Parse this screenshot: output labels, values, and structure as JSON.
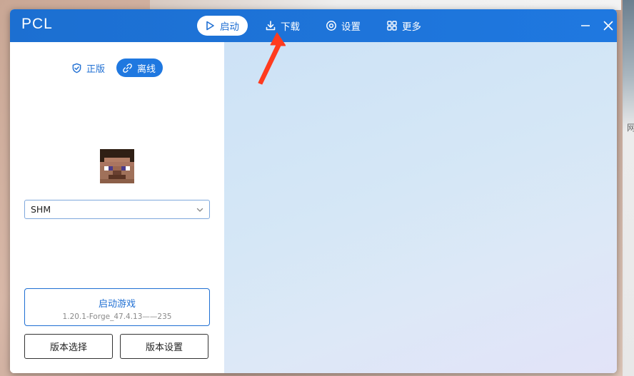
{
  "window": {
    "title": "PCL"
  },
  "nav": {
    "items": [
      {
        "label": "启动",
        "icon": "play-icon",
        "active": true
      },
      {
        "label": "下载",
        "icon": "download-icon",
        "active": false
      },
      {
        "label": "设置",
        "icon": "settings-icon",
        "active": false
      },
      {
        "label": "更多",
        "icon": "grid-icon",
        "active": false
      }
    ]
  },
  "account": {
    "tabs": [
      {
        "label": "正版",
        "icon": "shield-check-icon",
        "active": false
      },
      {
        "label": "离线",
        "icon": "link-icon",
        "active": true
      }
    ]
  },
  "user": {
    "selected": "SHM"
  },
  "launch": {
    "label": "启动游戏",
    "version": "1.20.1-Forge_47.4.13——235"
  },
  "buttons": {
    "version_select": "版本选择",
    "version_settings": "版本设置"
  },
  "desktop": {
    "side_text": "网"
  },
  "colors": {
    "accent": "#1f78e0",
    "titlebar": "#1c6fd1",
    "annotation": "#ff3b1f"
  }
}
